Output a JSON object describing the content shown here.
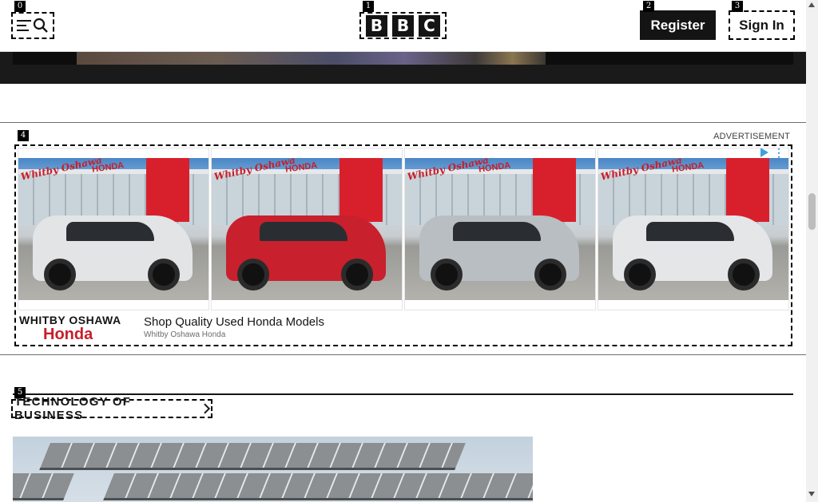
{
  "header": {
    "menu_tag": "0",
    "logo_tag": "1",
    "logo_letters": [
      "B",
      "B",
      "C"
    ],
    "register_tag": "2",
    "register_label": "Register",
    "signin_tag": "3",
    "signin_label": "Sign In"
  },
  "advertisement": {
    "tag": "4",
    "label": "ADVERTISEMENT",
    "brand_line1": "WHITBY OSHAWA",
    "brand_line2": "Honda",
    "headline": "Shop Quality Used Honda Models",
    "advertiser": "Whitby Oshawa Honda",
    "card_brand_text": "Whitby Oshawa",
    "card_sign_text": "HONDA",
    "car_colors": [
      "#e2e4e6",
      "#c8202c",
      "#b9bec3",
      "#e4e6e8"
    ]
  },
  "section": {
    "tag": "5",
    "title": "TECHNOLOGY OF BUSINESS"
  },
  "colors": {
    "ink": "#141414",
    "honda_red": "#c81e2a",
    "adchoices_blue": "#3fa0d8"
  }
}
